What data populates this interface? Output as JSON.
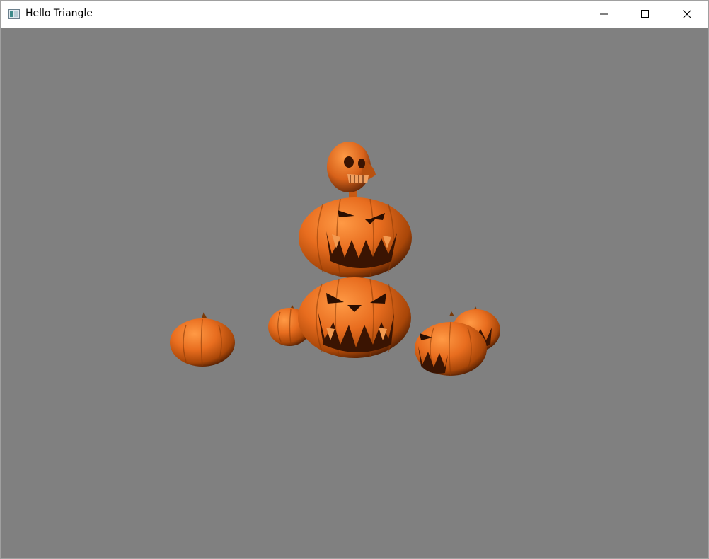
{
  "window": {
    "title": "Hello Triangle",
    "icon": "app-window-icon",
    "controls": [
      "minimize-icon",
      "maximize-icon",
      "close-icon"
    ]
  },
  "viewport": {
    "background": "#808080",
    "accent": "#e0681c"
  }
}
